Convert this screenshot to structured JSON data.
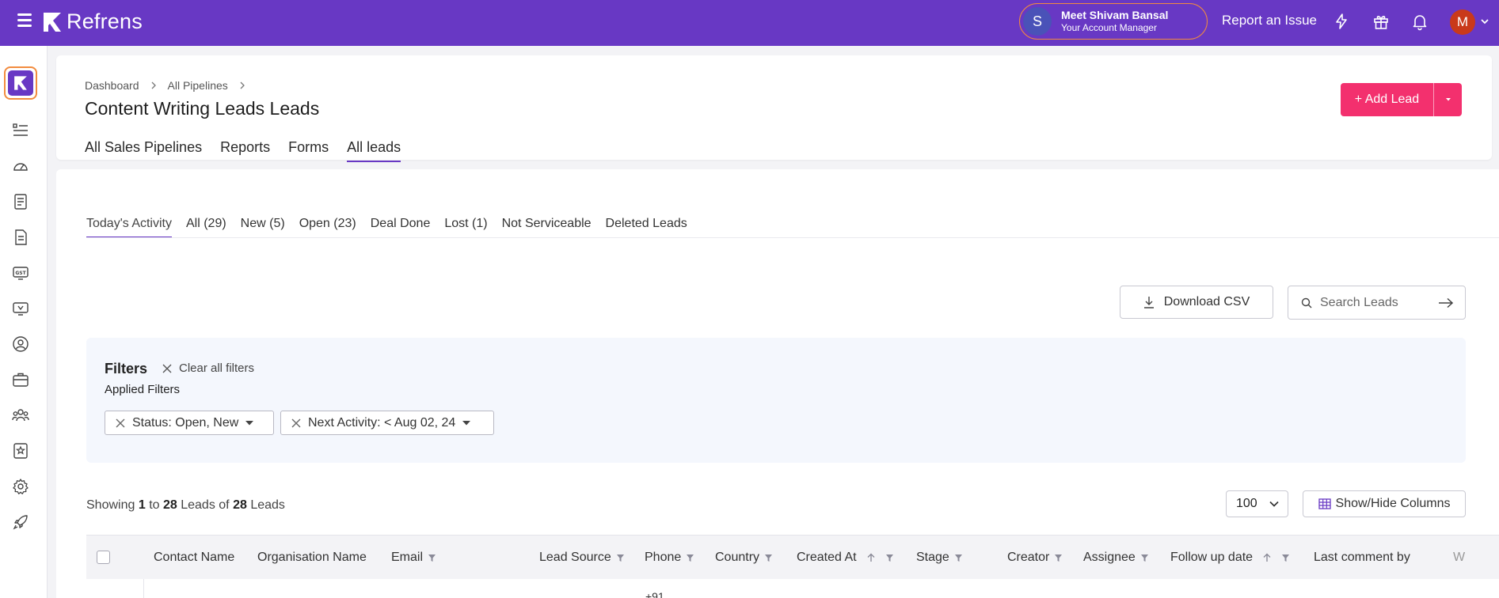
{
  "app": {
    "logo_text": "Refrens",
    "brand_color": "#6838c4",
    "accent_color": "#f3306e"
  },
  "topbar": {
    "account_manager": {
      "initial": "S",
      "name": "Meet Shivam Bansal",
      "role": "Your Account Manager"
    },
    "report_issue": "Report an Issue",
    "icons": [
      "lightning-icon",
      "gift-icon",
      "bell-icon"
    ],
    "user_initial": "M"
  },
  "sidebar": {
    "icons": [
      "refrens-logo-icon",
      "list-icon",
      "dashboard-gauge-icon",
      "document-icon",
      "invoice-icon",
      "gst-icon",
      "monitor-icon",
      "user-circle-icon",
      "briefcase-icon",
      "team-icon",
      "badge-icon",
      "settings-icon",
      "rocket-icon"
    ]
  },
  "header": {
    "breadcrumb": [
      "Dashboard",
      "All Pipelines"
    ],
    "title": "Content Writing Leads Leads",
    "tabs": [
      "All Sales Pipelines",
      "Reports",
      "Forms",
      "All leads"
    ],
    "active_tab": "All leads",
    "add_lead_label": "+ Add Lead"
  },
  "subtabs": {
    "items": [
      "Today's Activity",
      "All (29)",
      "New (5)",
      "Open (23)",
      "Deal Done",
      "Lost (1)",
      "Not Serviceable",
      "Deleted Leads"
    ],
    "active": "Today's Activity"
  },
  "actions": {
    "download_csv": "Download CSV",
    "search_placeholder": "Search Leads"
  },
  "filters": {
    "title": "Filters",
    "clear_all": "Clear all filters",
    "applied_label": "Applied Filters",
    "chips": [
      "Status: Open, New",
      "Next Activity: < Aug 02, 24"
    ]
  },
  "pagination": {
    "showing_prefix": "Showing",
    "from": "1",
    "to_word": "to",
    "to": "28",
    "leads_of": "Leads of",
    "total": "28",
    "suffix": "Leads",
    "per_page": "100",
    "show_hide_columns": "Show/Hide Columns"
  },
  "table": {
    "columns": [
      "Contact Name",
      "Organisation Name",
      "Email",
      "Lead Source",
      "Phone",
      "Country",
      "Created At",
      "Stage",
      "Creator",
      "Assignee",
      "Follow up date",
      "Last comment by",
      "W"
    ],
    "first_row_phone_peek": "+91"
  }
}
